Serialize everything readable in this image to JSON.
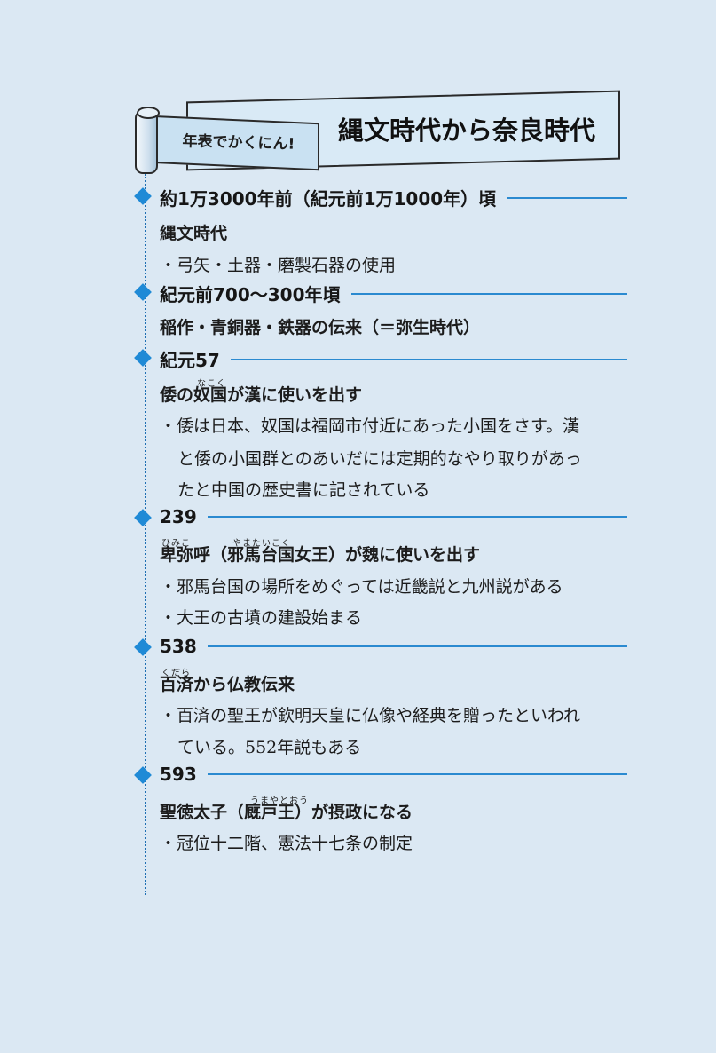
{
  "banner": {
    "subtitle": "年表でかくにん!",
    "title": "縄文時代から奈良時代"
  },
  "entries": [
    {
      "date": "約1万3000年前（紀元前1万1000年）頃",
      "title": "縄文時代",
      "notes": [
        "・弓矢・土器・磨製石器の使用"
      ]
    },
    {
      "date": "紀元前700〜300年頃",
      "title": "稲作・青銅器・鉄器の伝来（＝弥生時代）",
      "notes": []
    },
    {
      "date": "紀元57",
      "title": "倭の奴国が漢に使いを出す",
      "title_ruby": "なこく",
      "notes": [
        "・倭は日本、奴国は福岡市付近にあった小国をさす。漢",
        "と倭の小国群とのあいだには定期的なやり取りがあっ",
        "たと中国の歴史書に記されている"
      ]
    },
    {
      "date": "239",
      "title": "卑弥呼（邪馬台国女王）が魏に使いを出す",
      "title_ruby_1": "ひみこ",
      "title_ruby_2": "やまたいこく",
      "notes": [
        "・邪馬台国の場所をめぐっては近畿説と九州説がある",
        "・大王の古墳の建設始まる"
      ]
    },
    {
      "date": "538",
      "title": "百済から仏教伝来",
      "title_ruby": "くだら",
      "notes": [
        "・百済の聖王が欽明天皇に仏像や経典を贈ったといわれ",
        "ている。552年説もある"
      ]
    },
    {
      "date": "593",
      "title": "聖徳太子（厩戸王）が摂政になる",
      "title_ruby": "うまやとおう",
      "notes": [
        "・冠位十二階、憲法十七条の制定"
      ]
    }
  ],
  "colors": {
    "background": "#dbe8f3",
    "accent": "#1f8ad6",
    "rule": "#2b8ad0"
  }
}
